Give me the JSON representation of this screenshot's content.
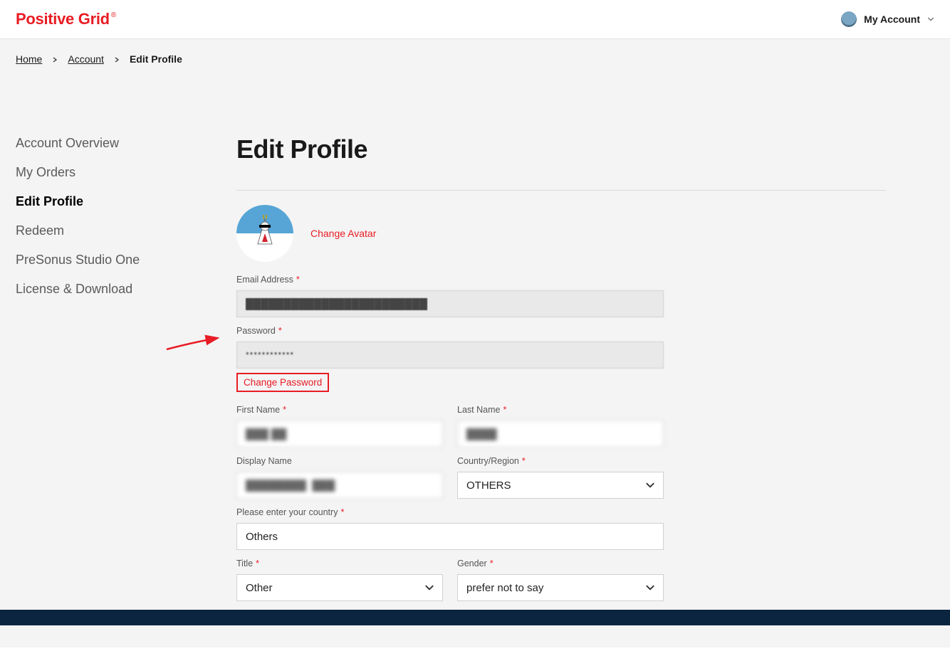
{
  "header": {
    "brand": "Positive Grid",
    "account_label": "My Account"
  },
  "breadcrumb": {
    "home": "Home",
    "account": "Account",
    "current": "Edit Profile"
  },
  "sidebar": {
    "items": [
      {
        "label": "Account Overview"
      },
      {
        "label": "My Orders"
      },
      {
        "label": "Edit Profile"
      },
      {
        "label": "Redeem"
      },
      {
        "label": "PreSonus Studio One"
      },
      {
        "label": "License & Download"
      }
    ],
    "active_index": 2
  },
  "page_title": "Edit Profile",
  "avatar": {
    "change_label": "Change Avatar"
  },
  "form": {
    "email": {
      "label": "Email Address",
      "value": "████████████████████████"
    },
    "password": {
      "label": "Password",
      "value": "************",
      "change_label": "Change Password"
    },
    "first_name": {
      "label": "First Name",
      "value": "███ ██"
    },
    "last_name": {
      "label": "Last Name",
      "value": "████"
    },
    "display_name": {
      "label": "Display Name",
      "value": "████████  ███"
    },
    "country_region": {
      "label": "Country/Region",
      "value": "OTHERS"
    },
    "enter_country": {
      "label": "Please enter your country",
      "value": "Others"
    },
    "title": {
      "label": "Title",
      "value": "Other"
    },
    "gender": {
      "label": "Gender",
      "value": "prefer not to say"
    }
  }
}
